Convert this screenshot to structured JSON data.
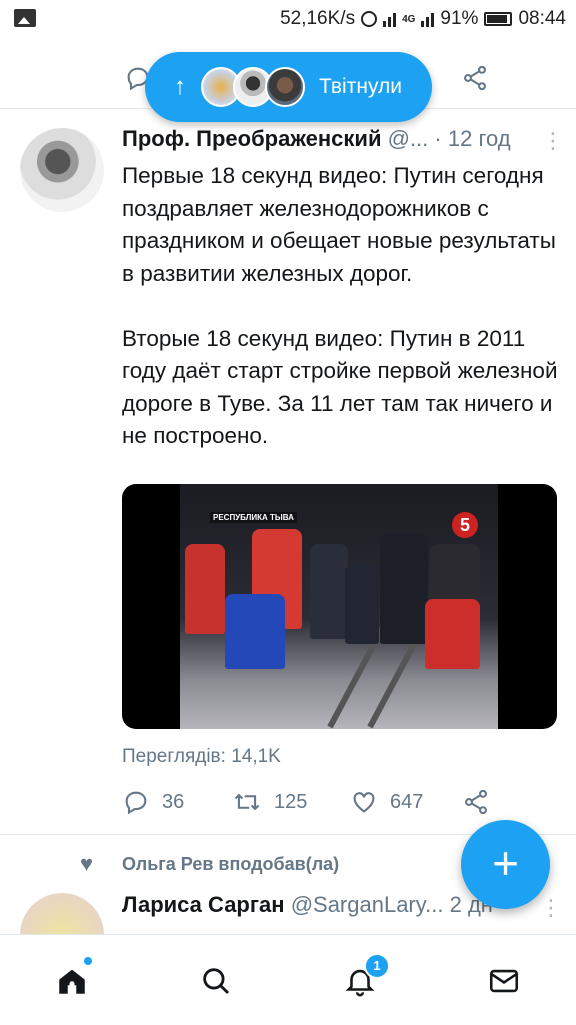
{
  "status_bar": {
    "speed": "52,16K/s",
    "network": "4G",
    "battery": "91%",
    "time": "08:44"
  },
  "retweet_pill": {
    "label": "Твітнули",
    "arrow": "↑"
  },
  "tweet": {
    "author_name": "Проф. Преображенский",
    "handle": "@...",
    "separator": "·",
    "time": "12 год",
    "text": "Первые 18 секунд видео: Путин сегодня поздравляет железнодорожников с праздником и обещает новые результаты в развитии железных дорог.\n\nВторые 18 секунд видео: Путин в 2011 году даёт старт стройке первой железной дороге в Туве. За 11 лет там так ничего и не построено.",
    "video_overlay_label": "РЕСПУБЛИКА ТЫВА",
    "video_channel_logo": "5",
    "views": "Переглядів: 14,1K",
    "replies": "36",
    "retweets": "125",
    "likes": "647"
  },
  "liked_by": {
    "text": "Ольга Рев вподобав(ла)"
  },
  "next_tweet": {
    "author_name": "Лариса Сарган",
    "handle": "@SarganLary...",
    "time": "2 дн"
  },
  "fab": {
    "label": "+"
  },
  "bottom_nav": {
    "notifications_badge": "1"
  },
  "colors": {
    "accent": "#1da1f2",
    "muted": "#657786",
    "divider": "#e1e8ed"
  }
}
